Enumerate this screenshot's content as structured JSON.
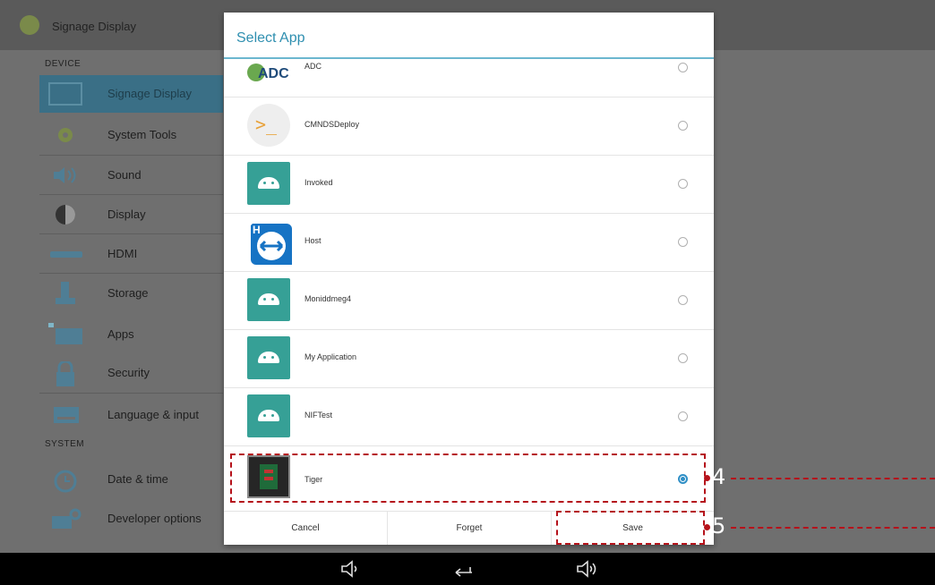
{
  "settings": {
    "title": "Signage Display",
    "section_device": "DEVICE",
    "section_system": "SYSTEM",
    "items": [
      {
        "label": "Signage Display",
        "icon": "monitor-icon",
        "selected": true
      },
      {
        "label": "System Tools",
        "icon": "gear-icon"
      },
      {
        "label": "Sound",
        "icon": "speaker-icon"
      },
      {
        "label": "Display",
        "icon": "contrast-icon"
      },
      {
        "label": "HDMI",
        "icon": "hdmi-icon"
      },
      {
        "label": "Storage",
        "icon": "storage-icon"
      },
      {
        "label": "Apps",
        "icon": "apps-icon"
      },
      {
        "label": "Security",
        "icon": "lock-icon"
      },
      {
        "label": "Language & input",
        "icon": "keyboard-icon"
      },
      {
        "label": "Date & time",
        "icon": "clock-icon"
      },
      {
        "label": "Developer options",
        "icon": "developer-icon"
      }
    ]
  },
  "dialog": {
    "title": "Select App",
    "apps": [
      {
        "name": "ADC",
        "icon": "adc-icon",
        "selected": false
      },
      {
        "name": "CMNDSDeploy",
        "icon": "terminal-icon",
        "selected": false
      },
      {
        "name": "Invoked",
        "icon": "android-icon",
        "selected": false
      },
      {
        "name": "Host",
        "icon": "teamviewer-icon",
        "selected": false
      },
      {
        "name": "Moniddmeg4",
        "icon": "android-icon",
        "selected": false
      },
      {
        "name": "My Application",
        "icon": "android-icon",
        "selected": false
      },
      {
        "name": "NIFTest",
        "icon": "android-icon",
        "selected": false
      },
      {
        "name": "Tiger",
        "icon": "tiger-icon",
        "selected": true
      }
    ],
    "buttons": {
      "cancel": "Cancel",
      "forget": "Forget",
      "save": "Save"
    }
  },
  "annotations": {
    "step4": "4",
    "step5": "5",
    "color": "#b5121b"
  },
  "navbar": {
    "icons": [
      "volume-down-icon",
      "back-icon",
      "volume-up-icon"
    ]
  }
}
